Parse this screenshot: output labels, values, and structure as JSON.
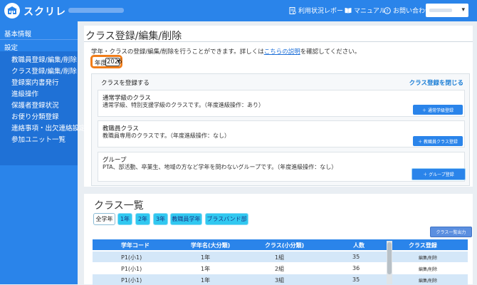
{
  "header": {
    "app_name": "スクリレ",
    "nav": [
      {
        "label": "利用状況レポート",
        "icon": "report-icon"
      },
      {
        "label": "マニュアル",
        "icon": "book-icon"
      },
      {
        "label": "お問い合わせ",
        "icon": "help-circle-icon"
      }
    ],
    "colors": {
      "primary": "#2a84ea",
      "accent_highlight": "#f07d1a",
      "tab_active": "#31c8f0"
    }
  },
  "sidebar": {
    "sections": [
      {
        "label": "基本情報"
      },
      {
        "label": "設定"
      }
    ],
    "items": [
      {
        "label": "教職員登録/編集/削除"
      },
      {
        "label": "クラス登録/編集/削除"
      },
      {
        "label": "登録案内書発行"
      },
      {
        "label": "進級操作"
      },
      {
        "label": "保護者登録状況"
      },
      {
        "label": "お便り分類登録"
      },
      {
        "label": "連絡事項・出欠連絡設定"
      },
      {
        "label": "参加ユニット一覧"
      }
    ]
  },
  "main": {
    "title": "クラス登録/編集/削除",
    "desc_before": "学年・クラスの登録/編集/削除を行うことができます。詳しくは",
    "desc_link": "こちらの説明",
    "desc_after": "を確認してください。",
    "year_label": "年度",
    "year_value": "2025",
    "register": {
      "title": "クラスを登録する",
      "close_label": "クラス登録を閉じる",
      "cards": [
        {
          "title": "通常学級のクラス",
          "desc": "通常学級、特別支援学級のクラスです。（年度進級操作：あり）",
          "button": "＋ 通常学級登録"
        },
        {
          "title": "教職員クラス",
          "desc": "教職員専用のクラスです。（年度進級操作：なし）",
          "button": "＋ 教職員クラス登録"
        },
        {
          "title": "グループ",
          "desc": "PTA、部活動、卒業生、地域の方など学年を問わないグループです。（年度進級操作：なし）",
          "button": "＋ グループ登録"
        }
      ]
    }
  },
  "class_list": {
    "title": "クラス一覧",
    "tabs": [
      "全学年",
      "1年",
      "2年",
      "3年",
      "教職員学年",
      "ブラスバンド部"
    ],
    "selected_tab": "全学年",
    "export_label": "クラス一覧出力",
    "columns": [
      "学年コード",
      "学年名(大分類)",
      "クラス(小分類)",
      "人数",
      "クラス登録"
    ],
    "rows": [
      {
        "code": "P1(小1)",
        "grade": "1年",
        "class": "1組",
        "count": "35",
        "action": "編集/削除"
      },
      {
        "code": "P1(小1)",
        "grade": "1年",
        "class": "2組",
        "count": "36",
        "action": "編集/削除"
      },
      {
        "code": "P1(小1)",
        "grade": "1年",
        "class": "3組",
        "count": "35",
        "action": "編集/削除"
      }
    ]
  }
}
